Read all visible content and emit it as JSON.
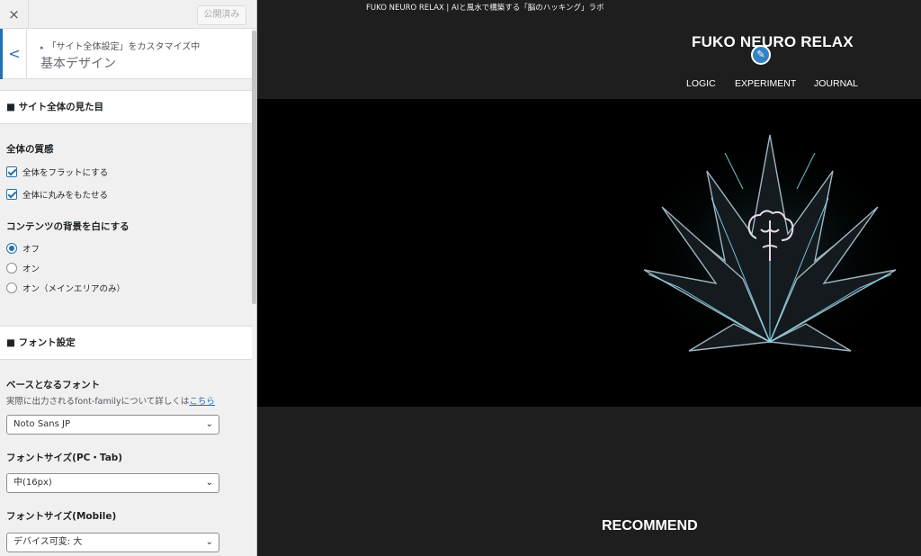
{
  "topbar": {
    "close_icon": "×",
    "publish_label": "公開済み"
  },
  "section": {
    "breadcrumb": "「サイト全体設定」をカスタマイズ中",
    "title": "基本デザイン",
    "back_icon": "<"
  },
  "groups": {
    "appearance_heading": "■ サイト全体の見た目",
    "texture_label": "全体の質感",
    "texture_options": [
      {
        "label": "全体をフラットにする",
        "checked": true
      },
      {
        "label": "全体に丸みをもたせる",
        "checked": true
      }
    ],
    "content_bg_label": "コンテンツの背景を白にする",
    "content_bg_options": [
      {
        "label": "オフ",
        "checked": true
      },
      {
        "label": "オン",
        "checked": false
      },
      {
        "label": "オン（メインエリアのみ）",
        "checked": false
      }
    ],
    "font_heading": "■ フォント設定",
    "base_font_label": "ベースとなるフォント",
    "base_font_desc": "実際に出力されるfont-familyについて詳しくは",
    "base_font_link": "こちら",
    "base_font_value": "Noto Sans JP",
    "font_size_pc_label": "フォントサイズ(PC・Tab)",
    "font_size_pc_value": "中(16px)",
    "font_size_mobile_label": "フォントサイズ(Mobile)",
    "font_size_mobile_value": "デバイス可変: 大"
  },
  "preview": {
    "tagline": "FUKO NEURO RELAX | AIと風水で構築する「脳のハッキング」ラボ",
    "site_title": "FUKO NEURO RELAX",
    "nav": [
      "LOGIC",
      "EXPERIMENT",
      "JOURNAL"
    ],
    "recommend": "RECOMMEND"
  },
  "colors": {
    "accent": "#2271b1",
    "sidebar_bg": "#f0f0f1",
    "preview_bg": "#1e1e1e",
    "hero_bg": "#000000",
    "edit_shortcut": "#3582c4"
  },
  "icons": {
    "close": "close-icon",
    "back": "chevron-left-icon",
    "select": "chevron-down-icon",
    "edit": "pencil-icon"
  }
}
